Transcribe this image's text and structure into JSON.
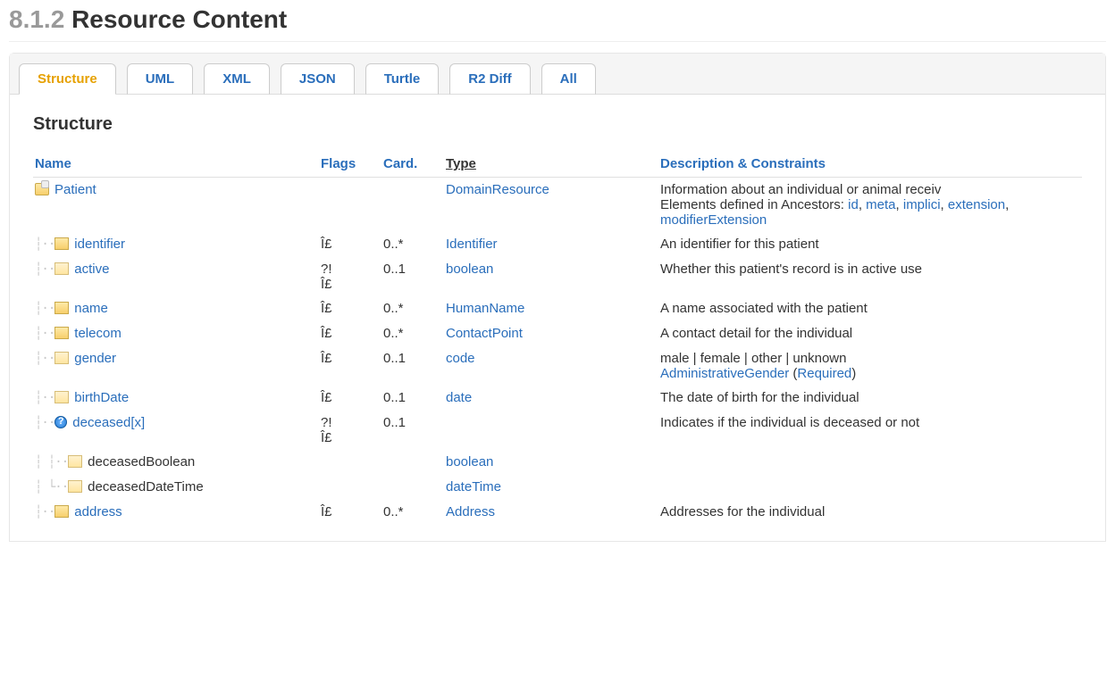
{
  "header": {
    "section_number": "8.1.2",
    "title": "Resource Content"
  },
  "tabs": [
    {
      "label": "Structure",
      "active": true
    },
    {
      "label": "UML"
    },
    {
      "label": "XML"
    },
    {
      "label": "JSON"
    },
    {
      "label": "Turtle"
    },
    {
      "label": "R2 Diff"
    },
    {
      "label": "All"
    }
  ],
  "section_heading": "Structure",
  "columns": {
    "name": "Name",
    "flags": "Flags",
    "card": "Card.",
    "type": "Type",
    "desc": "Description & Constraints"
  },
  "rows": [
    {
      "id": "patient",
      "icon": "folder",
      "tree": "",
      "level": 0,
      "name": "Patient",
      "name_is_link": true,
      "flags": "",
      "card": "",
      "type": "DomainResource",
      "desc": "Information about an individual or animal receiv",
      "ancestors_prefix": "Elements defined in Ancestors: ",
      "ancestors": [
        "id",
        "meta",
        "implici",
        "extension",
        "modifierExtension"
      ]
    },
    {
      "id": "identifier",
      "icon": "cube",
      "tree": "┆·· ",
      "level": 1,
      "name": "identifier",
      "name_is_link": true,
      "flags": "Î£",
      "card": "0..*",
      "type": "Identifier",
      "desc": "An identifier for this patient"
    },
    {
      "id": "active",
      "icon": "prim",
      "tree": "┆·· ",
      "level": 1,
      "name": "active",
      "name_is_link": true,
      "flags": "?!\nÎ£",
      "card": "0..1",
      "type": "boolean",
      "desc": "Whether this patient's record is in active use"
    },
    {
      "id": "name",
      "icon": "cube",
      "tree": "┆·· ",
      "level": 1,
      "name": "name",
      "name_is_link": true,
      "flags": "Î£",
      "card": "0..*",
      "type": "HumanName",
      "desc": "A name associated with the patient"
    },
    {
      "id": "telecom",
      "icon": "cube",
      "tree": "┆·· ",
      "level": 1,
      "name": "telecom",
      "name_is_link": true,
      "flags": "Î£",
      "card": "0..*",
      "type": "ContactPoint",
      "desc": "A contact detail for the individual"
    },
    {
      "id": "gender",
      "icon": "prim",
      "tree": "┆·· ",
      "level": 1,
      "name": "gender",
      "name_is_link": true,
      "flags": "Î£",
      "card": "0..1",
      "type": "code",
      "desc": "male | female | other | unknown",
      "binding_link": "AdministrativeGender",
      "binding_strength": "Required"
    },
    {
      "id": "birthDate",
      "icon": "prim",
      "tree": "┆·· ",
      "level": 1,
      "name": "birthDate",
      "name_is_link": true,
      "flags": "Î£",
      "card": "0..1",
      "type": "date",
      "desc": "The date of birth for the individual"
    },
    {
      "id": "deceased",
      "icon": "choice",
      "tree": "┆·· ",
      "level": 1,
      "name": "deceased[x]",
      "name_is_link": true,
      "flags": "?!\nÎ£",
      "card": "0..1",
      "type": "",
      "desc": "Indicates if the individual is deceased or not"
    },
    {
      "id": "deceasedBoolean",
      "icon": "prim",
      "tree": "┆   ┆·· ",
      "level": 2,
      "name": "deceasedBoolean",
      "name_is_link": false,
      "flags": "",
      "card": "",
      "type": "boolean",
      "desc": ""
    },
    {
      "id": "deceasedDateTime",
      "icon": "prim",
      "tree": "┆   └·· ",
      "level": 2,
      "name": "deceasedDateTime",
      "name_is_link": false,
      "flags": "",
      "card": "",
      "type": "dateTime",
      "desc": ""
    },
    {
      "id": "address",
      "icon": "cube",
      "tree": "┆·· ",
      "level": 1,
      "name": "address",
      "name_is_link": true,
      "flags": "Î£",
      "card": "0..*",
      "type": "Address",
      "desc": "Addresses for the individual"
    }
  ]
}
